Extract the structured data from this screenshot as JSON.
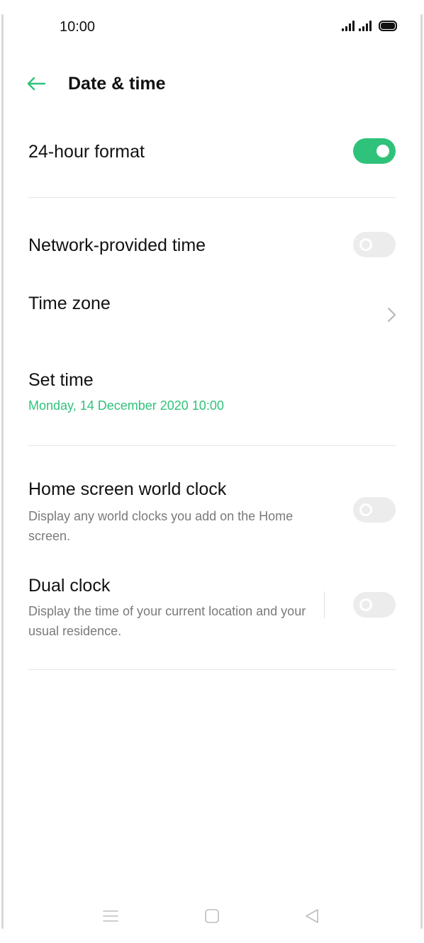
{
  "status_bar": {
    "time": "10:00",
    "icons": [
      "signal-icon",
      "signal-icon",
      "battery-icon"
    ]
  },
  "header": {
    "back_icon": "arrow-left-icon",
    "title": "Date & time"
  },
  "settings": {
    "hour_format": {
      "title": "24-hour format",
      "enabled": true
    },
    "network_time": {
      "title": "Network-provided time",
      "enabled": false
    },
    "time_zone": {
      "title": "Time zone",
      "icon": "chevron-right-icon"
    },
    "set_time": {
      "title": "Set time",
      "value": "Monday, 14 December 2020  10:00"
    },
    "world_clock": {
      "title": "Home screen world clock",
      "subtitle": "Display any world clocks you add on the Home screen.",
      "enabled": false
    },
    "dual_clock": {
      "title": "Dual clock",
      "subtitle": "Display the time of your current location and your usual residence.",
      "enabled": false
    }
  },
  "nav_bar": {
    "icons": [
      "menu-icon",
      "home-icon",
      "back-triangle-icon"
    ]
  },
  "colors": {
    "accent": "#2fc27a",
    "toggle_off": "#ececec",
    "text_primary": "#111111",
    "text_secondary": "#7a7a7a",
    "divider": "#e6e6e6"
  }
}
